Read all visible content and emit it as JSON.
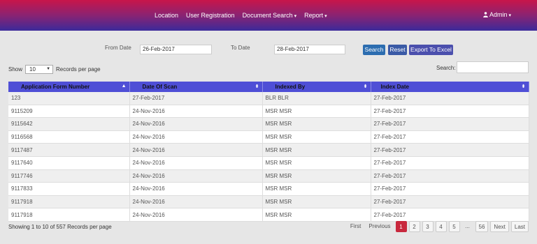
{
  "nav": {
    "items": [
      {
        "label": "Location",
        "dropdown": false
      },
      {
        "label": "User Registration",
        "dropdown": false
      },
      {
        "label": "Document Search",
        "dropdown": true
      },
      {
        "label": "Report",
        "dropdown": true
      }
    ],
    "user_label": "Admin"
  },
  "filter": {
    "from_label": "From Date",
    "from_value": "26-Feb-2017",
    "to_label": "To Date",
    "to_value": "28-Feb-2017",
    "search_button": "Search",
    "reset_button": "Reset",
    "export_button": "Export To Excel"
  },
  "table_controls": {
    "show_label": "Show",
    "page_size": "10",
    "records_label": "Records per page",
    "search_label": "Search:"
  },
  "table": {
    "headers": [
      "Application Form Number",
      "Date Of Scan",
      "Indexed By",
      "Index Date"
    ],
    "rows": [
      [
        "123",
        "27-Feb-2017",
        "BLR BLR",
        "27-Feb-2017"
      ],
      [
        "9115209",
        "24-Nov-2016",
        "MSR MSR",
        "27-Feb-2017"
      ],
      [
        "9115642",
        "24-Nov-2016",
        "MSR MSR",
        "27-Feb-2017"
      ],
      [
        "9116568",
        "24-Nov-2016",
        "MSR MSR",
        "27-Feb-2017"
      ],
      [
        "9117487",
        "24-Nov-2016",
        "MSR MSR",
        "27-Feb-2017"
      ],
      [
        "9117640",
        "24-Nov-2016",
        "MSR MSR",
        "27-Feb-2017"
      ],
      [
        "9117746",
        "24-Nov-2016",
        "MSR MSR",
        "27-Feb-2017"
      ],
      [
        "9117833",
        "24-Nov-2016",
        "MSR MSR",
        "27-Feb-2017"
      ],
      [
        "9117918",
        "24-Nov-2016",
        "MSR MSR",
        "27-Feb-2017"
      ],
      [
        "9117918",
        "24-Nov-2016",
        "MSR MSR",
        "27-Feb-2017"
      ]
    ]
  },
  "footer": {
    "info": "Showing 1 to 10 of 557 Records per page"
  },
  "pagination": {
    "first": "First",
    "previous": "Previous",
    "pages": [
      "1",
      "2",
      "3",
      "4",
      "5"
    ],
    "active_page": "1",
    "ellipsis": "...",
    "last_page": "56",
    "next": "Next",
    "last": "Last"
  },
  "colors": {
    "header_gradient_top": "#c8154a",
    "header_gradient_bottom": "#3b2a9a",
    "table_header": "#4f4fd6",
    "active_page": "#c8283d"
  }
}
